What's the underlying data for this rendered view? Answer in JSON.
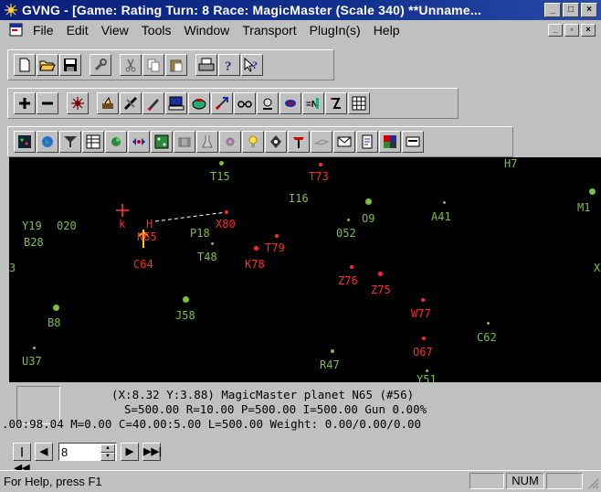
{
  "window": {
    "title": "GVNG - [Game: Rating  Turn: 8  Race: MagicMaster (Scale 340) **Unname...",
    "caption_buttons": [
      "_",
      "□",
      "×"
    ],
    "mdi_buttons": [
      "_",
      "▫",
      "×"
    ]
  },
  "menu": [
    "File",
    "Edit",
    "View",
    "Tools",
    "Window",
    "Transport",
    "PlugIn(s)",
    "Help"
  ],
  "toolbar1": [
    "new-doc-icon",
    "open-folder-icon",
    "save-disk-icon",
    "wrench-icon",
    "cut-icon",
    "copy-icon",
    "paste-icon",
    "print-icon",
    "help-icon",
    "context-help-icon"
  ],
  "toolbar2": [
    "zoom-in-icon",
    "zoom-out-icon",
    "sun-icon",
    "build-icon",
    "ship-icon",
    "pen-icon",
    "computer-icon",
    "route-icon",
    "send-icon",
    "glasses-icon",
    "planet-filter-icon",
    "mask-icon",
    "coords-icon",
    "turn-icon",
    "grid-icon"
  ],
  "toolbar3": [
    "map-icon",
    "globe-icon",
    "filter-icon",
    "table-icon",
    "planet-icon",
    "fleet-icon",
    "dice-icon",
    "group-icon",
    "science-icon",
    "gear-icon",
    "light-icon",
    "ship-class-icon",
    "signpost-icon",
    "battle-icon",
    "mail-icon",
    "report-icon",
    "colors-icon",
    "options-icon"
  ],
  "map": {
    "planets": [
      {
        "name": "H7",
        "color": "green"
      },
      {
        "name": "T15",
        "color": "green"
      },
      {
        "name": "T73",
        "color": "red"
      },
      {
        "name": "I16",
        "color": "green"
      },
      {
        "name": "M1",
        "color": "green"
      },
      {
        "name": "Y19",
        "color": "green"
      },
      {
        "name": "020",
        "color": "green"
      },
      {
        "name": "k",
        "color": "red"
      },
      {
        "name": "H",
        "color": "red"
      },
      {
        "name": "N65",
        "color": "red"
      },
      {
        "name": "P18",
        "color": "green"
      },
      {
        "name": "X80",
        "color": "red"
      },
      {
        "name": "O9",
        "color": "green"
      },
      {
        "name": "A41",
        "color": "green"
      },
      {
        "name": "B28",
        "color": "green"
      },
      {
        "name": "052",
        "color": "green"
      },
      {
        "name": "T79",
        "color": "red"
      },
      {
        "name": "T48",
        "color": "green"
      },
      {
        "name": "K78",
        "color": "red"
      },
      {
        "name": "C64",
        "color": "red"
      },
      {
        "name": "3",
        "color": "green"
      },
      {
        "name": "X",
        "color": "green"
      },
      {
        "name": "Z76",
        "color": "red"
      },
      {
        "name": "Z75",
        "color": "red"
      },
      {
        "name": "J58",
        "color": "green"
      },
      {
        "name": "W77",
        "color": "red"
      },
      {
        "name": "B8",
        "color": "green"
      },
      {
        "name": "C62",
        "color": "green"
      },
      {
        "name": "O67",
        "color": "red"
      },
      {
        "name": "U37",
        "color": "green"
      },
      {
        "name": "R47",
        "color": "green"
      },
      {
        "name": "Y51",
        "color": "green"
      }
    ]
  },
  "info": {
    "line1": "(X:8.32 Y:3.88) MagicMaster planet N65 (#56)",
    "line2": "S=500.00 R=10.00 P=500.00 I=500.00     Gun 0.00%",
    "line3": ".00:98.04 M=0.00 C=40.00:5.00 L=500.00     Weight: 0.00/0.00/0.00"
  },
  "nav": {
    "first": "|◀◀",
    "prev": "◀",
    "turn_value": "8",
    "next": "▶",
    "last": "▶▶|"
  },
  "status": {
    "help": "For Help, press F1",
    "num": "NUM"
  },
  "colors": {
    "titlebar": "#0a1f7a",
    "map_bg": "#000000",
    "friendly": "#7fbf3f",
    "enemy": "#ff2a2a"
  }
}
